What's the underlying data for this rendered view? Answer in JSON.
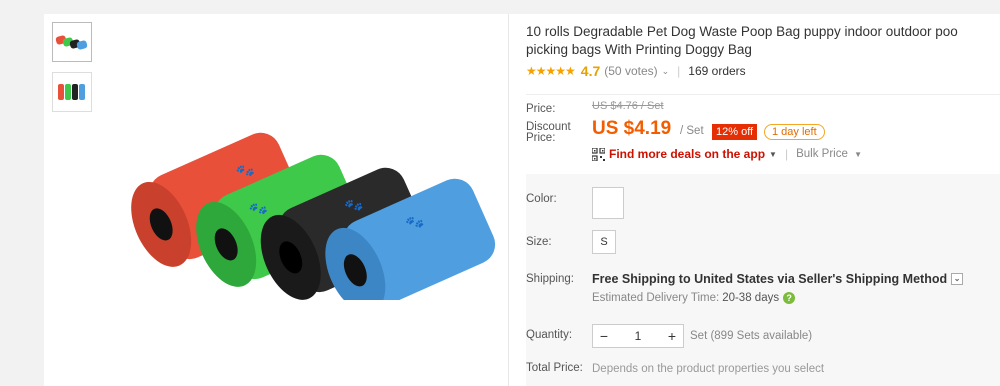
{
  "product": {
    "title": "10 rolls Degradable Pet Dog Waste Poop Bag puppy indoor outdoor poo picking bags With Printing Doggy Bag",
    "stars": "★★★★★",
    "rating": "4.7",
    "votes": "(50 votes)",
    "orders": "169 orders"
  },
  "pricing": {
    "price_label": "Price:",
    "old_price": "US $4.76 / Set",
    "discount_label": "Discount Price:",
    "price": "US $4.19",
    "unit": "/ Set",
    "off_badge": "12% off",
    "timer": "1 day left",
    "deals_link": "Find more deals on the app",
    "bulk_price": "Bulk Price"
  },
  "options": {
    "color_label": "Color:",
    "size_label": "Size:",
    "size_value": "S",
    "shipping_label": "Shipping:",
    "shipping_text": "Free Shipping to United States via Seller's Shipping Method",
    "delivery_label": "Estimated Delivery Time:",
    "delivery_value": "20-38 days",
    "quantity_label": "Quantity:",
    "quantity_value": "1",
    "availability": "Set (899 Sets available)",
    "total_label": "Total Price:",
    "total_note": "Depends on the product properties you select"
  },
  "colors": {
    "roll_red": "#e8503a",
    "roll_green": "#3fc94a",
    "roll_black": "#222222",
    "roll_blue": "#4f9ee0",
    "price_orange": "#f25d00",
    "badge_red": "#e62e04",
    "star_gold": "#f7a100"
  }
}
